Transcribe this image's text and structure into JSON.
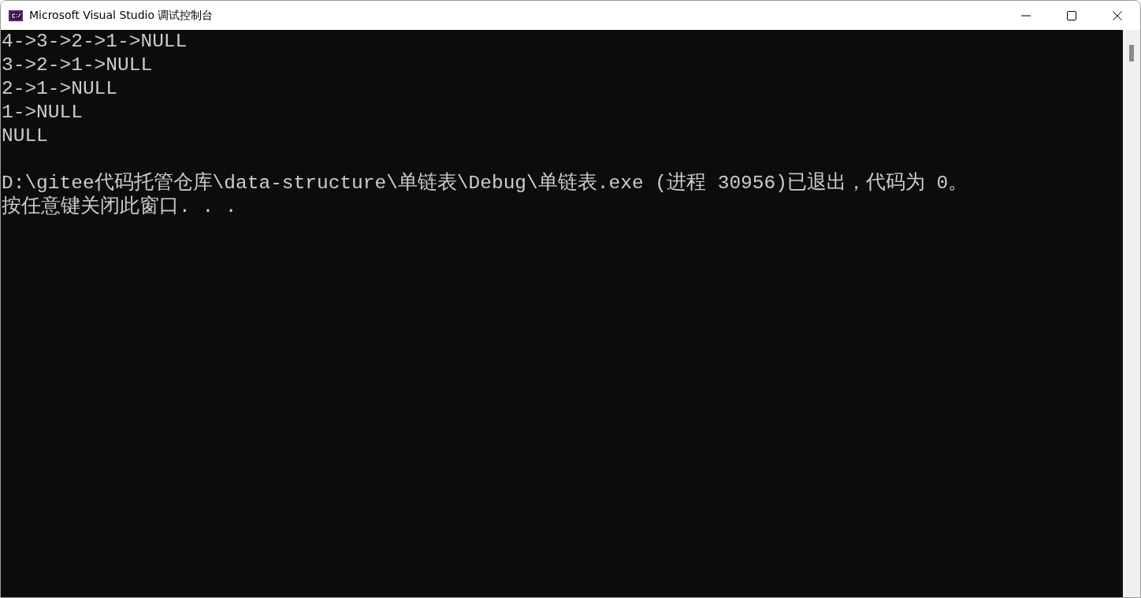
{
  "window": {
    "title": "Microsoft Visual Studio 调试控制台"
  },
  "console": {
    "output": [
      "4->3->2->1->NULL",
      "3->2->1->NULL",
      "2->1->NULL",
      "1->NULL",
      "NULL"
    ],
    "exit_message": [
      "D:\\gitee代码托管仓库\\data-structure\\单链表\\Debug\\单链表.exe (进程 30956)已退出，代码为 0。",
      "按任意键关闭此窗口. . ."
    ]
  }
}
